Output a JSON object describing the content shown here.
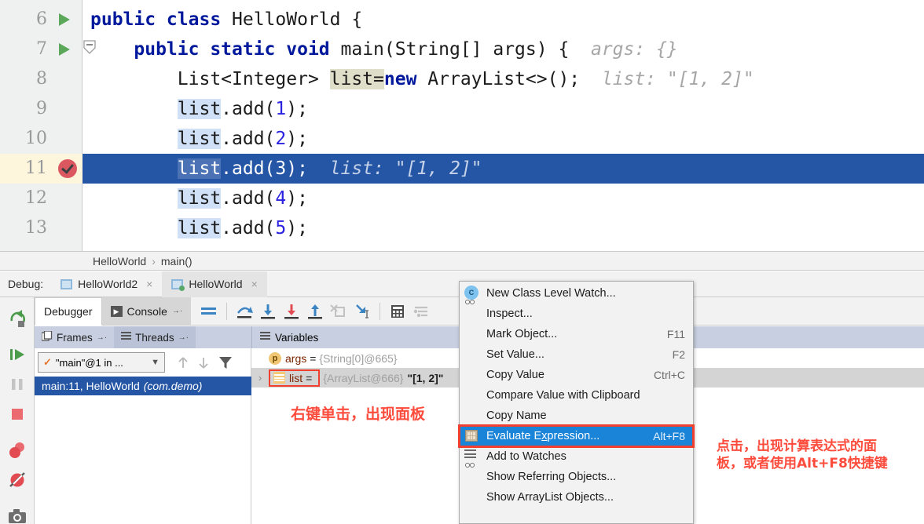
{
  "editor": {
    "lines": [
      {
        "num": "6",
        "marker": "run-arrow",
        "indent": 0,
        "segments": [
          {
            "t": "public class ",
            "c": "kw"
          },
          {
            "t": "HelloWorld {",
            "c": "pln"
          }
        ]
      },
      {
        "num": "7",
        "marker": "run-arrow-fold",
        "indent": 0,
        "segments": [
          {
            "t": "    ",
            "c": "pln"
          },
          {
            "t": "public static void ",
            "c": "kw"
          },
          {
            "t": "main(String[] args) { ",
            "c": "pln"
          },
          {
            "t": " args: {}",
            "c": "hint"
          }
        ]
      },
      {
        "num": "8",
        "marker": "",
        "indent": 0,
        "segments": [
          {
            "t": "        List<Integer> ",
            "c": "pln"
          },
          {
            "t": "list",
            "c": "pln hl-decl"
          },
          {
            "t": "=",
            "c": "pln hl-decl"
          },
          {
            "t": "new",
            "c": "kw"
          },
          {
            "t": " ArrayList<>(); ",
            "c": "pln"
          },
          {
            "t": " list: \"[1, 2]\"",
            "c": "hint"
          }
        ]
      },
      {
        "num": "9",
        "marker": "",
        "indent": 0,
        "segments": [
          {
            "t": "        ",
            "c": "pln"
          },
          {
            "t": "list",
            "c": "pln hl-use"
          },
          {
            "t": ".add(",
            "c": "pln"
          },
          {
            "t": "1",
            "c": "num"
          },
          {
            "t": ");",
            "c": "pln"
          }
        ]
      },
      {
        "num": "10",
        "marker": "",
        "indent": 0,
        "segments": [
          {
            "t": "        ",
            "c": "pln"
          },
          {
            "t": "list",
            "c": "pln hl-use"
          },
          {
            "t": ".add(",
            "c": "pln"
          },
          {
            "t": "2",
            "c": "num"
          },
          {
            "t": ");",
            "c": "pln"
          }
        ]
      },
      {
        "num": "11",
        "marker": "breakpoint",
        "current": true,
        "segments": [
          {
            "t": "        ",
            "c": "pln"
          },
          {
            "t": "list",
            "c": "pln hl-use"
          },
          {
            "t": ".add(3);  ",
            "c": "pln"
          },
          {
            "t": "list: \"[1, 2]\"",
            "c": "hint"
          }
        ]
      },
      {
        "num": "12",
        "marker": "",
        "indent": 0,
        "segments": [
          {
            "t": "        ",
            "c": "pln"
          },
          {
            "t": "list",
            "c": "pln hl-use"
          },
          {
            "t": ".add(",
            "c": "pln"
          },
          {
            "t": "4",
            "c": "num"
          },
          {
            "t": ");",
            "c": "pln"
          }
        ]
      },
      {
        "num": "13",
        "marker": "",
        "indent": 0,
        "segments": [
          {
            "t": "        ",
            "c": "pln"
          },
          {
            "t": "list",
            "c": "pln hl-use"
          },
          {
            "t": ".add(",
            "c": "pln"
          },
          {
            "t": "5",
            "c": "num"
          },
          {
            "t": ");",
            "c": "pln"
          }
        ]
      }
    ]
  },
  "breadcrumb": {
    "class": "HelloWorld",
    "sep": "›",
    "method": "main()"
  },
  "debug_toolwindow": {
    "label": "Debug:",
    "tabs": [
      {
        "name": "HelloWorld2",
        "active": false,
        "close": "×"
      },
      {
        "name": "HelloWorld",
        "active": true,
        "close": "×"
      }
    ]
  },
  "rail": {
    "icons": [
      "rerun-icon",
      "resume-program-icon",
      "pause-program-icon",
      "stop-icon",
      "view-breakpoints-icon",
      "mute-breakpoints-icon",
      "screenshot-icon"
    ]
  },
  "debugger_toolbar": {
    "tabs": [
      {
        "label": "Debugger",
        "selected": true
      },
      {
        "label": "Console",
        "selected": false,
        "pin": "→·"
      }
    ],
    "icons": [
      "show-execution-point-icon",
      "step-over-icon",
      "step-into-icon",
      "force-step-into-icon",
      "step-out-icon",
      "drop-frame-icon",
      "run-to-cursor-icon",
      "evaluate-expression-icon",
      "settings-icon"
    ]
  },
  "frames_panel": {
    "tabs": [
      {
        "label": "Frames",
        "active": true,
        "pin": "→·"
      },
      {
        "label": "Threads",
        "active": false,
        "pin": "→·"
      }
    ],
    "thread_selector": "\"main\"@1 in ...",
    "thread_check": "✓",
    "chevron": "⌵",
    "stack": [
      {
        "text": "main:11, HelloWorld",
        "pkg": "(com.demo)",
        "selected": true
      }
    ]
  },
  "variables_panel": {
    "title": "Variables",
    "rows": [
      {
        "twisty": "",
        "icon": "p",
        "name": "args",
        "eq": "=",
        "ref": "{String[0]@665}",
        "value": "",
        "selected": false,
        "boxed": false
      },
      {
        "twisty": "›",
        "icon": "list",
        "name": "list",
        "eq": "=",
        "ref": "{ArrayList@666}",
        "value": "\"[1, 2]\"",
        "selected": true,
        "boxed": true
      }
    ]
  },
  "context_menu": {
    "items": [
      {
        "label": "New Class Level Watch...",
        "accel": "",
        "icon": "new-class-level-watch-icon",
        "selected": false
      },
      {
        "label": "Inspect...",
        "accel": "",
        "icon": "",
        "selected": false
      },
      {
        "label": "Mark Object...",
        "accel": "F11",
        "icon": "",
        "selected": false
      },
      {
        "label": "Set Value...",
        "accel": "F2",
        "icon": "",
        "selected": false
      },
      {
        "label": "Copy Value",
        "accel": "Ctrl+C",
        "icon": "",
        "selected": false
      },
      {
        "label": "Compare Value with Clipboard",
        "accel": "",
        "icon": "",
        "selected": false
      },
      {
        "label": "Copy Name",
        "accel": "",
        "icon": "",
        "selected": false
      },
      {
        "label": "Evaluate Expression...",
        "accel": "Alt+F8",
        "icon": "evaluate-expression-icon",
        "selected": true,
        "mnemonic": "x"
      },
      {
        "label": "Add to Watches",
        "accel": "",
        "icon": "add-to-watches-icon",
        "selected": false
      },
      {
        "label": "Show Referring Objects...",
        "accel": "",
        "icon": "",
        "selected": false
      },
      {
        "label": "Show ArrayList Objects...",
        "accel": "",
        "icon": "",
        "selected": false
      }
    ]
  },
  "annotations": {
    "variables_note": "右键单击，出现面板",
    "menu_note_line1": "点击，出现计算表达式的面",
    "menu_note_line2": "板，或者使用Alt+F8快捷键"
  },
  "colors": {
    "exec_line": "#2556a5",
    "accent_red": "#fd4b3c",
    "menu_highlight": "#1a84d8",
    "panel_header": "#c7cfe0",
    "use_highlight": "#cfe0f7",
    "decl_highlight": "#dfdec8"
  }
}
